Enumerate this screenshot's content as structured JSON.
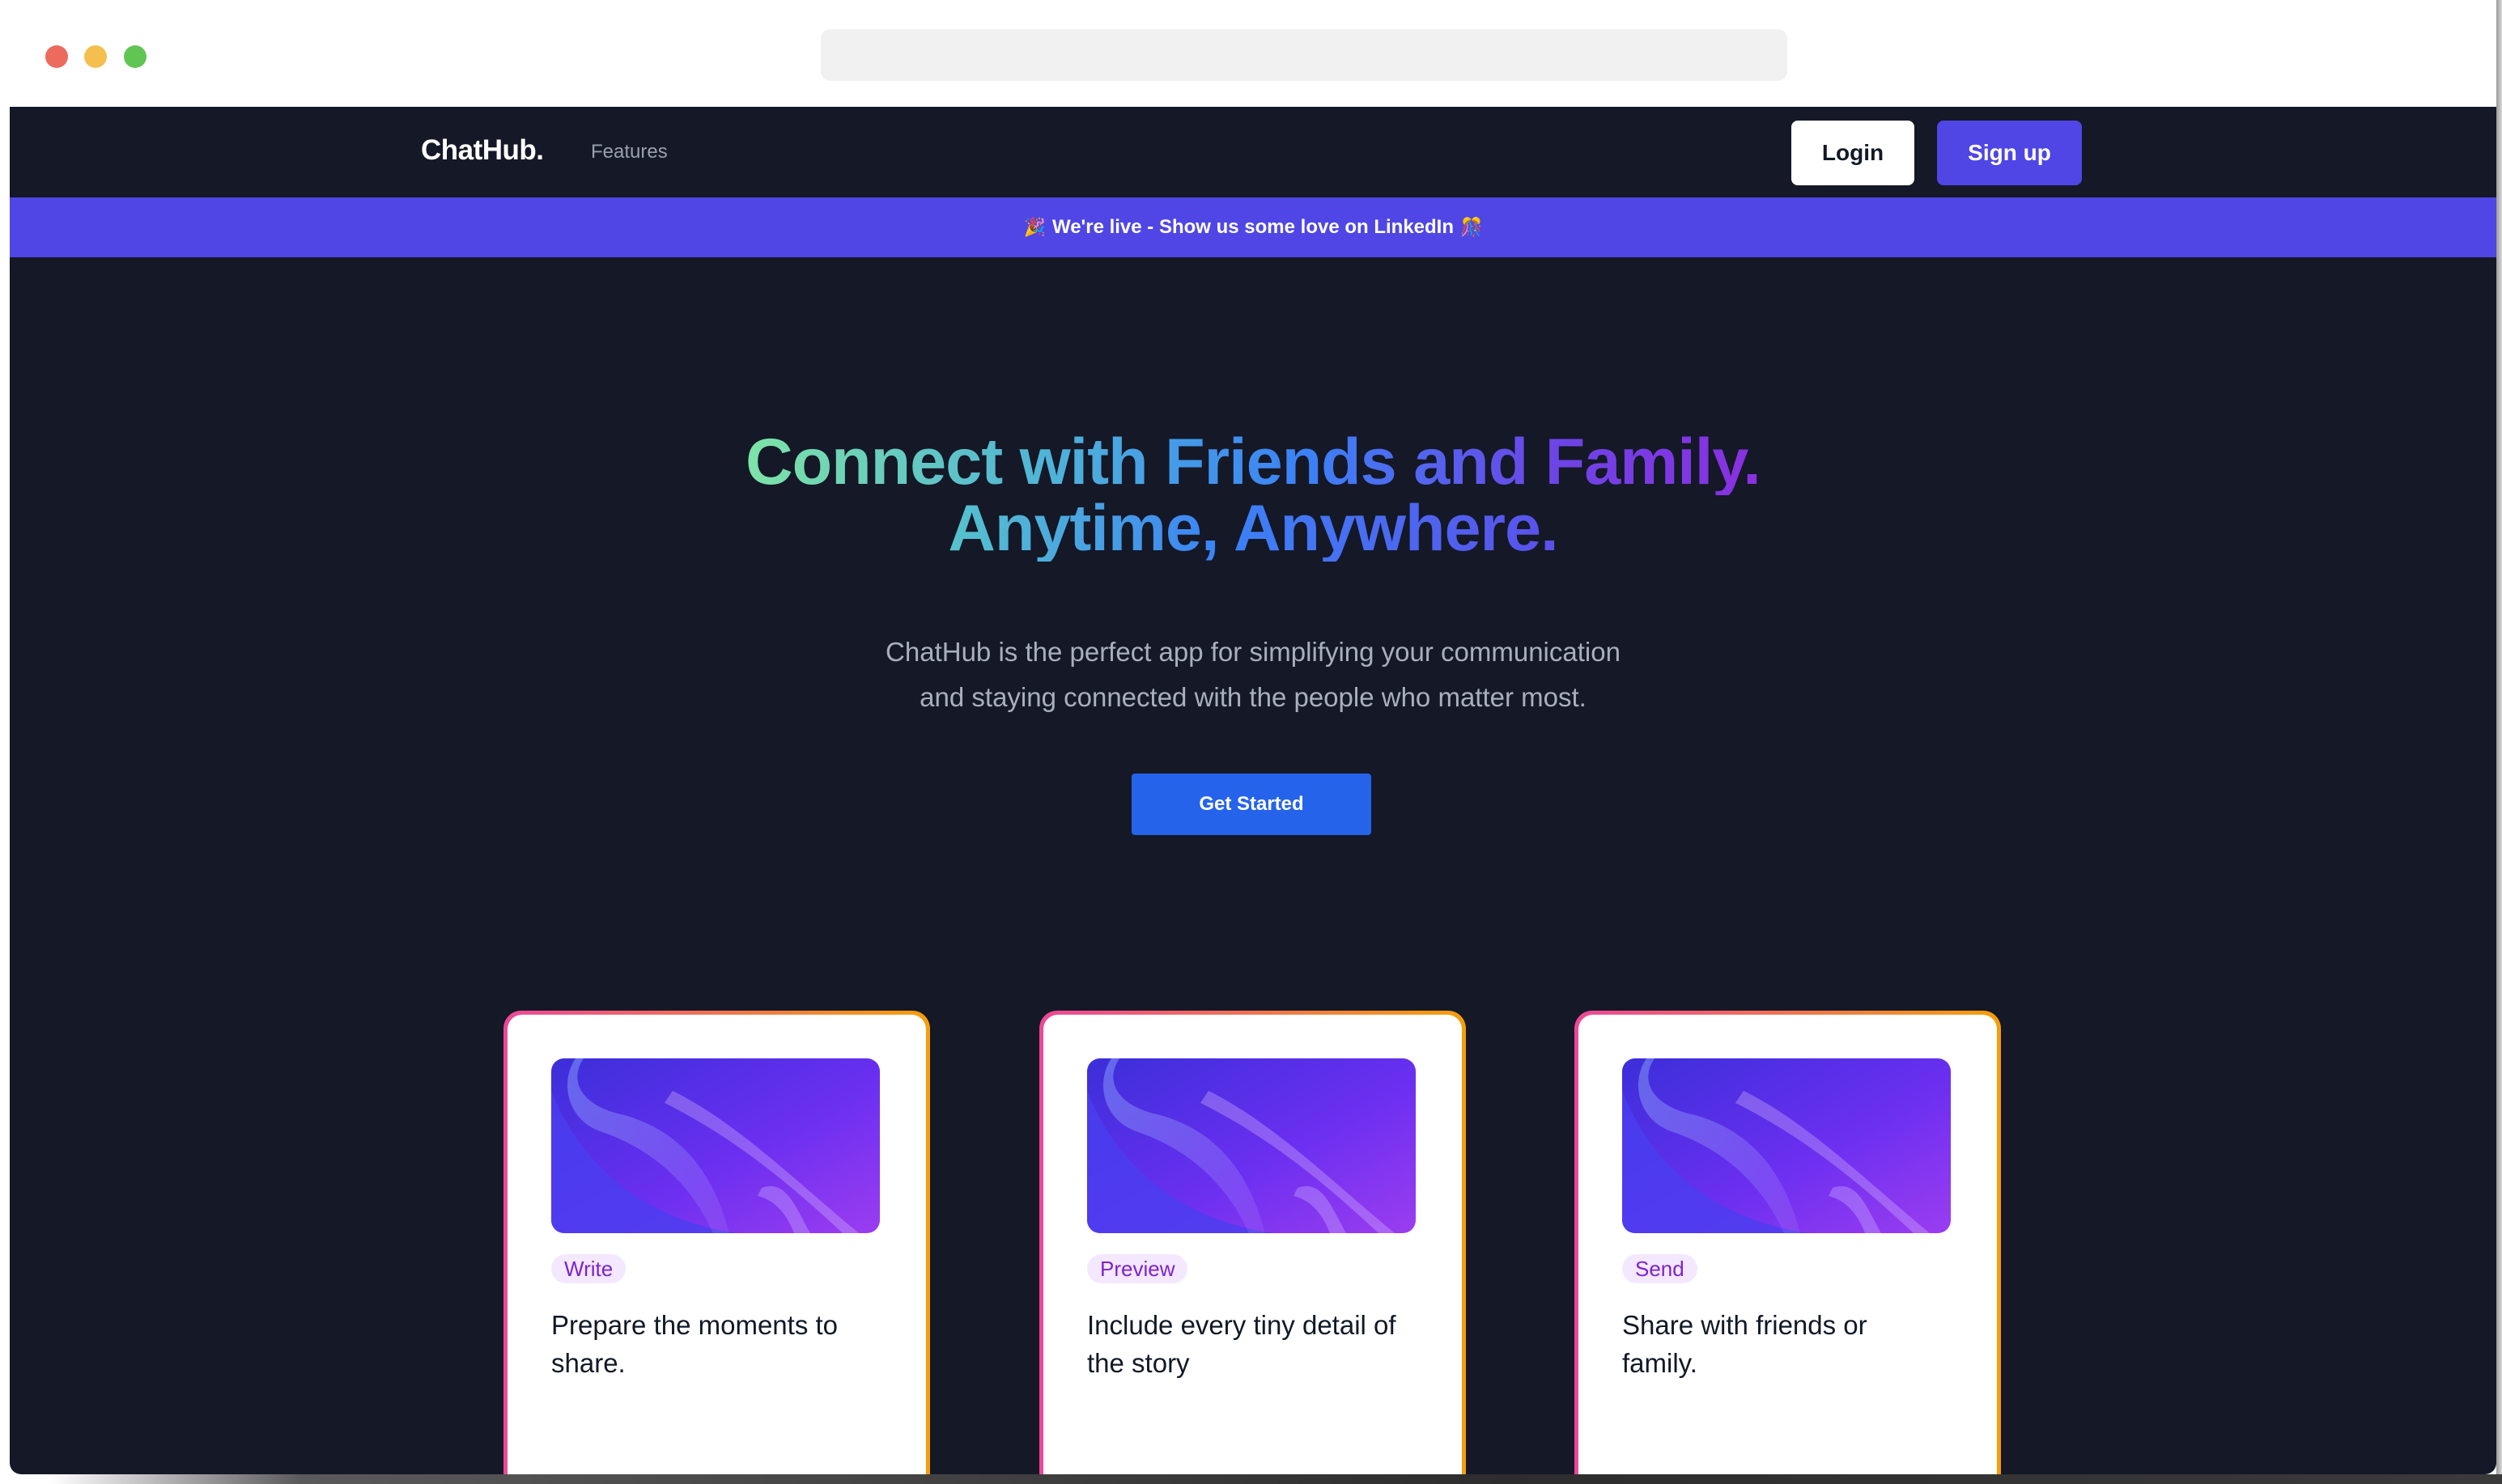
{
  "nav": {
    "logo": "ChatHub.",
    "links": [
      {
        "label": "Features"
      }
    ],
    "login_label": "Login",
    "signup_label": "Sign up"
  },
  "banner": {
    "text": "We're live - Show us some love on LinkedIn",
    "emoji_left": "🎉",
    "emoji_right": "🎊"
  },
  "hero": {
    "title_line1": "Connect with Friends and Family.",
    "title_line2": "Anytime, Anywhere.",
    "subtitle_line1": "ChatHub is the perfect app for simplifying your communication",
    "subtitle_line2": "and staying connected with the people who matter most.",
    "cta_label": "Get Started"
  },
  "cards": [
    {
      "tag": "Write",
      "text": "Prepare the moments to share."
    },
    {
      "tag": "Preview",
      "text": "Include every tiny detail of the story"
    },
    {
      "tag": "Send",
      "text": "Share with friends or family."
    }
  ],
  "colors": {
    "background": "#141827",
    "brand": "#4f46e5",
    "cta": "#2563eb",
    "tag_bg": "#f3e8ff",
    "tag_text": "#7e22ce",
    "card_border_start": "#ec4899",
    "card_border_end": "#f59e0b"
  },
  "icons": {
    "browser_controls": [
      "close-dot",
      "minimize-dot",
      "maximize-dot"
    ]
  }
}
